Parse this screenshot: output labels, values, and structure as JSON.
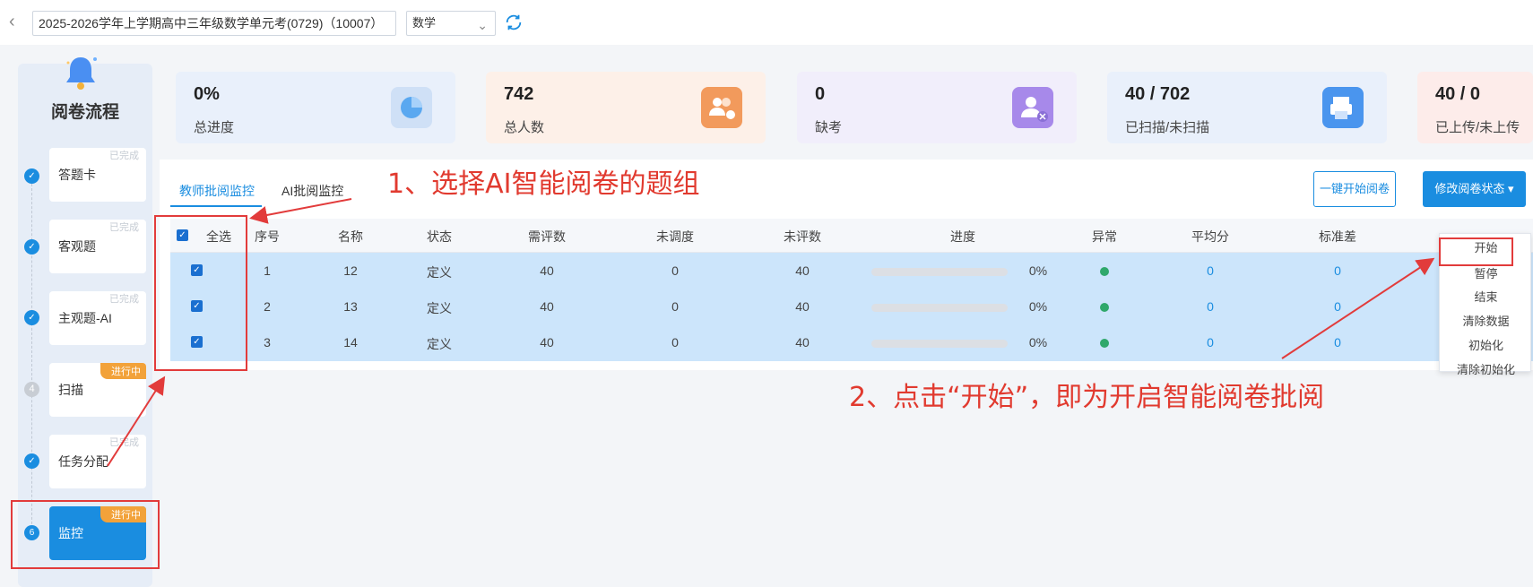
{
  "topbar": {
    "exam_value": "2025-2026学年上学期高中三年级数学单元考(0729)（10007）",
    "subject_value": "数学"
  },
  "sidebar": {
    "title": "阅卷流程",
    "steps": [
      {
        "label": "答题卡",
        "status": "已完成",
        "marker": "✓"
      },
      {
        "label": "客观题",
        "status": "已完成",
        "marker": "✓"
      },
      {
        "label": "主观题-AI",
        "status": "已完成",
        "marker": "✓"
      },
      {
        "label": "扫描",
        "status": "进行中",
        "marker": "4"
      },
      {
        "label": "任务分配",
        "status": "已完成",
        "marker": "✓"
      },
      {
        "label": "监控",
        "status": "进行中",
        "marker": "6"
      }
    ]
  },
  "stats": [
    {
      "value": "0%",
      "label": "总进度",
      "color": "#e9f0fb",
      "icon": "pie-chart-icon"
    },
    {
      "value": "742",
      "label": "总人数",
      "color": "#fdf0e8",
      "icon": "users-icon"
    },
    {
      "value": "0",
      "label": "缺考",
      "color": "#f1eefb",
      "icon": "user-absent-icon"
    },
    {
      "value": "40 / 702",
      "label": "已扫描/未扫描",
      "color": "#e9f0fb",
      "icon": "scanner-icon"
    },
    {
      "value": "40 / 0",
      "label": "已上传/未上传",
      "color": "#fdecea",
      "icon": "upload-icon"
    }
  ],
  "tabs": [
    {
      "label": "教师批阅监控",
      "active": true
    },
    {
      "label": "AI批阅监控",
      "active": false
    }
  ],
  "buttons": {
    "start_all": "一键开始阅卷",
    "change_status": "修改阅卷状态"
  },
  "table": {
    "select_all": "全选",
    "headers": [
      "序号",
      "名称",
      "状态",
      "需评数",
      "未调度",
      "未评数",
      "进度",
      "异常",
      "平均分",
      "标准差"
    ],
    "rows": [
      {
        "index": "1",
        "name": "12",
        "status": "定义",
        "need": "40",
        "undispatched": "0",
        "unmarked": "40",
        "progress_pct": "0%",
        "progress": 0,
        "avg": "0",
        "std": "0"
      },
      {
        "index": "2",
        "name": "13",
        "status": "定义",
        "need": "40",
        "undispatched": "0",
        "unmarked": "40",
        "progress_pct": "0%",
        "progress": 0,
        "avg": "0",
        "std": "0"
      },
      {
        "index": "3",
        "name": "14",
        "status": "定义",
        "need": "40",
        "undispatched": "0",
        "unmarked": "40",
        "progress_pct": "0%",
        "progress": 0,
        "avg": "0",
        "std": "0"
      }
    ]
  },
  "dropdown": [
    "开始",
    "暂停",
    "结束",
    "清除数据",
    "初始化",
    "清除初始化"
  ],
  "annotations": {
    "step1": "1、选择AI智能阅卷的题组",
    "step2": "2、点击“开始”，即为开启智能阅卷批阅"
  },
  "colors": {
    "accent": "#1a8de0",
    "annotation": "#e13a2f",
    "ongoing_tag": "#f2a23a",
    "selected_row": "#cce5fb"
  }
}
